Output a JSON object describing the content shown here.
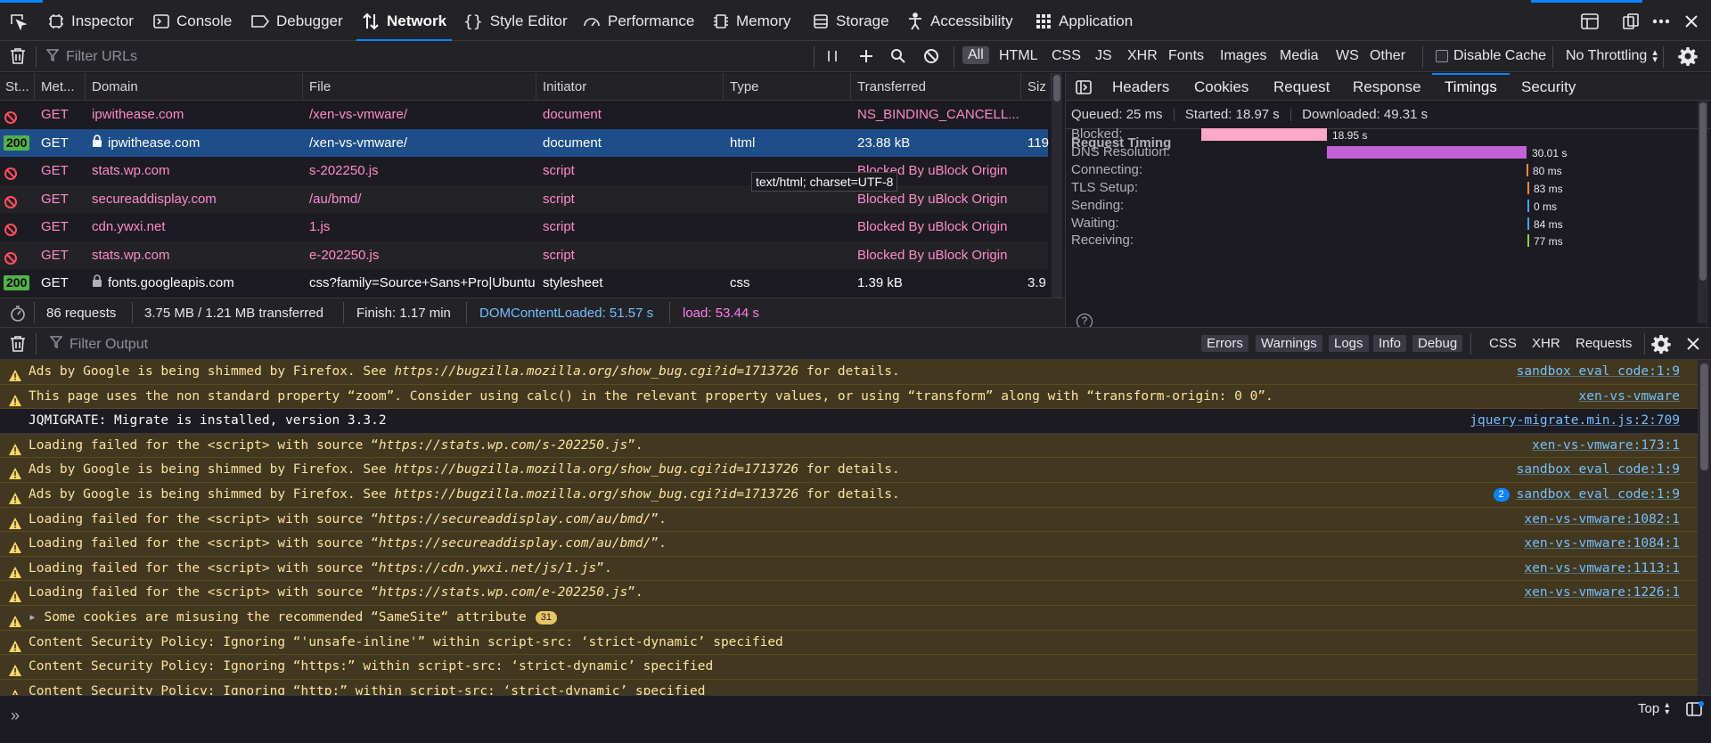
{
  "toolbar": {
    "tabs": [
      {
        "label": "Inspector"
      },
      {
        "label": "Console"
      },
      {
        "label": "Debugger"
      },
      {
        "label": "Network"
      },
      {
        "label": "Style Editor"
      },
      {
        "label": "Performance"
      },
      {
        "label": "Memory"
      },
      {
        "label": "Storage"
      },
      {
        "label": "Accessibility"
      },
      {
        "label": "Application"
      }
    ],
    "active_tab": "Network"
  },
  "network_bar": {
    "filter_placeholder": "Filter URLs",
    "type_filters": [
      "All",
      "HTML",
      "CSS",
      "JS",
      "XHR",
      "Fonts",
      "Images",
      "Media",
      "WS",
      "Other"
    ],
    "active_filter": "All",
    "disable_cache_label": "Disable Cache",
    "throttling": "No Throttling"
  },
  "table": {
    "columns": [
      "St...",
      "Met...",
      "Domain",
      "File",
      "Initiator",
      "Type",
      "Transferred",
      "Siz"
    ],
    "rows": [
      {
        "status": "blocked",
        "method": "GET",
        "domain": "ipwithease.com",
        "file": "/xen-vs-vmware/",
        "initiator": "document",
        "type": "",
        "transferred": "NS_BINDING_CANCELL...",
        "size": ""
      },
      {
        "status": "200",
        "method": "GET",
        "domain": "ipwithease.com",
        "file": "/xen-vs-vmware/",
        "initiator": "document",
        "type": "html",
        "transferred": "23.88 kB",
        "size": "119",
        "secure": true,
        "selected": true
      },
      {
        "status": "blocked",
        "method": "GET",
        "domain": "stats.wp.com",
        "file": "s-202250.js",
        "initiator": "script",
        "type": "",
        "transferred": "Blocked By uBlock Origin",
        "size": ""
      },
      {
        "status": "blocked",
        "method": "GET",
        "domain": "secureaddisplay.com",
        "file": "/au/bmd/",
        "initiator": "script",
        "type": "",
        "transferred": "Blocked By uBlock Origin",
        "size": ""
      },
      {
        "status": "blocked",
        "method": "GET",
        "domain": "cdn.ywxi.net",
        "file": "1.js",
        "initiator": "script",
        "type": "",
        "transferred": "Blocked By uBlock Origin",
        "size": ""
      },
      {
        "status": "blocked",
        "method": "GET",
        "domain": "stats.wp.com",
        "file": "e-202250.js",
        "initiator": "script",
        "type": "",
        "transferred": "Blocked By uBlock Origin",
        "size": ""
      },
      {
        "status": "200",
        "method": "GET",
        "domain": "fonts.googleapis.com",
        "file": "css?family=Source+Sans+Pro|Ubuntu",
        "initiator": "stylesheet",
        "type": "css",
        "transferred": "1.39 kB",
        "size": "3.9",
        "secure": true
      }
    ],
    "tooltip": "text/html; charset=UTF-8"
  },
  "summary": {
    "requests": "86 requests",
    "size": "3.75 MB / 1.21 MB transferred",
    "finish": "Finish: 1.17 min",
    "dcl": "DOMContentLoaded: 51.57 s",
    "load": "load: 53.44 s"
  },
  "side_panel": {
    "tabs": [
      "Headers",
      "Cookies",
      "Request",
      "Response",
      "Timings",
      "Security"
    ],
    "active_tab": "Timings",
    "queued": "Queued: 25 ms",
    "started": "Started: 18.97 s",
    "downloaded": "Downloaded: 49.31 s",
    "section_title": "Request Timing",
    "timings": [
      {
        "label": "Blocked:",
        "value": "18.95 s",
        "color": "#ffa8c8"
      },
      {
        "label": "DNS Resolution:",
        "value": "30.01 s",
        "color": "#c163d6"
      },
      {
        "label": "Connecting:",
        "value": "80 ms",
        "color": "#ff8a3d"
      },
      {
        "label": "TLS Setup:",
        "value": "83 ms",
        "color": "#ff8a3d"
      },
      {
        "label": "Sending:",
        "value": "0 ms",
        "color": "#45a1ff"
      },
      {
        "label": "Waiting:",
        "value": "84 ms",
        "color": "#45a1ff"
      },
      {
        "label": "Receiving:",
        "value": "77 ms",
        "color": "#7fd650"
      }
    ]
  },
  "console_bar": {
    "filter_placeholder": "Filter Output",
    "levels": [
      "Errors",
      "Warnings",
      "Logs",
      "Info",
      "Debug"
    ],
    "extras": [
      "CSS",
      "XHR",
      "Requests"
    ]
  },
  "console": {
    "messages": [
      {
        "level": "warn",
        "parts": [
          [
            "Ads by Google is being shimmed by Firefox. See ",
            false
          ],
          [
            "https://bugzilla.mozilla.org/show_bug.cgi?id=1713726",
            true
          ],
          [
            " for details.",
            false
          ]
        ],
        "source": "sandbox eval code:1:9"
      },
      {
        "level": "warn",
        "parts": [
          [
            "This page uses the non standard property “zoom”. Consider using calc() in the relevant property values, or using “transform” along with “transform-origin: 0 0”.",
            false
          ]
        ],
        "source": "xen-vs-vmware"
      },
      {
        "level": "log",
        "parts": [
          [
            "JQMIGRATE: Migrate is installed, version 3.3.2",
            false
          ]
        ],
        "source": "jquery-migrate.min.js:2:709"
      },
      {
        "level": "warn",
        "parts": [
          [
            "Loading failed for the <script> with source “",
            false
          ],
          [
            "https://stats.wp.com/s-202250.js",
            true
          ],
          [
            "”.",
            false
          ]
        ],
        "source": "xen-vs-vmware:173:1"
      },
      {
        "level": "warn",
        "parts": [
          [
            "Ads by Google is being shimmed by Firefox. See ",
            false
          ],
          [
            "https://bugzilla.mozilla.org/show_bug.cgi?id=1713726",
            true
          ],
          [
            " for details.",
            false
          ]
        ],
        "source": "sandbox eval code:1:9"
      },
      {
        "level": "warn",
        "parts": [
          [
            "Ads by Google is being shimmed by Firefox. See ",
            false
          ],
          [
            "https://bugzilla.mozilla.org/show_bug.cgi?id=1713726",
            true
          ],
          [
            " for details.",
            false
          ]
        ],
        "source": "sandbox eval code:1:9",
        "repeat": "2"
      },
      {
        "level": "warn",
        "parts": [
          [
            "Loading failed for the <script> with source “",
            false
          ],
          [
            "https://secureaddisplay.com/au/bmd/",
            true
          ],
          [
            "”.",
            false
          ]
        ],
        "source": "xen-vs-vmware:1082:1"
      },
      {
        "level": "warn",
        "parts": [
          [
            "Loading failed for the <script> with source “",
            false
          ],
          [
            "https://secureaddisplay.com/au/bmd/",
            true
          ],
          [
            "”.",
            false
          ]
        ],
        "source": "xen-vs-vmware:1084:1"
      },
      {
        "level": "warn",
        "parts": [
          [
            "Loading failed for the <script> with source “",
            false
          ],
          [
            "https://cdn.ywxi.net/js/1.js",
            true
          ],
          [
            "”.",
            false
          ]
        ],
        "source": "xen-vs-vmware:1113:1"
      },
      {
        "level": "warn",
        "parts": [
          [
            "Loading failed for the <script> with source “",
            false
          ],
          [
            "https://stats.wp.com/e-202250.js",
            true
          ],
          [
            "”.",
            false
          ]
        ],
        "source": "xen-vs-vmware:1226:1"
      },
      {
        "level": "warn",
        "parts": [
          [
            "Some cookies are misusing the recommended “SameSite“ attribute",
            false
          ]
        ],
        "source": "",
        "group_count": "31"
      },
      {
        "level": "warn",
        "parts": [
          [
            "Content Security Policy: Ignoring “'unsafe-inline'” within script-src: ‘strict-dynamic’ specified",
            false
          ]
        ],
        "source": ""
      },
      {
        "level": "warn",
        "parts": [
          [
            "Content Security Policy: Ignoring “https:” within script-src: ‘strict-dynamic’ specified",
            false
          ]
        ],
        "source": ""
      },
      {
        "level": "warn",
        "parts": [
          [
            "Content Security Policy: Ignoring “http:” within script-src: ‘strict-dynamic’ specified",
            false
          ]
        ],
        "source": ""
      }
    ]
  },
  "input_bar": {
    "context": "Top"
  }
}
